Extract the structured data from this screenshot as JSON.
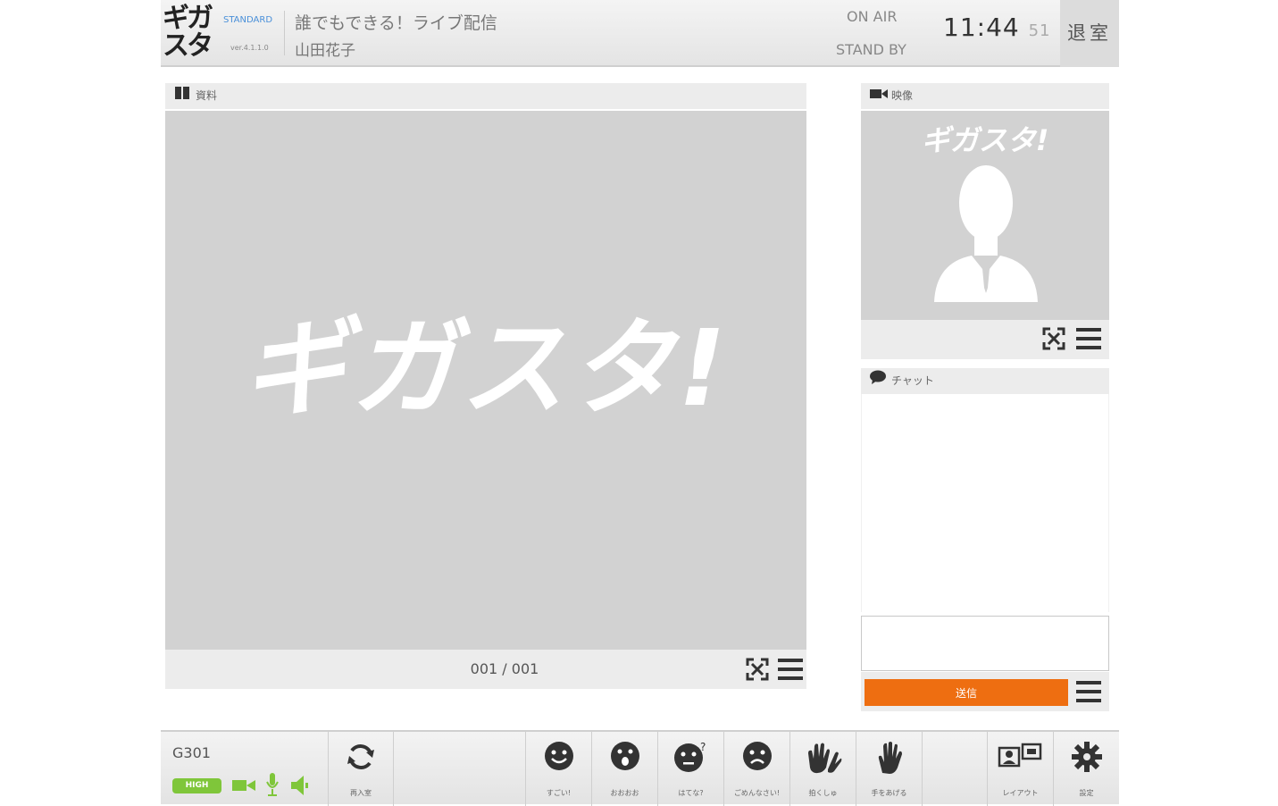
{
  "header": {
    "logo": "ギガスタ",
    "edition": "STANDARD",
    "version": "ver.4.1.1.0",
    "room_title": "誰でもできる！ライブ配信",
    "user_name": "山田花子",
    "status_onair": "ON AIR",
    "status_standby": "STAND BY",
    "clock_hm": "11:44",
    "clock_sec": "51",
    "exit_label": "退室"
  },
  "document_panel": {
    "title": "資料",
    "logo_text": "ギガスタ!",
    "page_counter": "001 / 001"
  },
  "video_panel": {
    "title": "映像",
    "logo_text": "ギガスタ!"
  },
  "chat_panel": {
    "title": "チャット",
    "input_value": "",
    "send_label": "送信"
  },
  "toolbar": {
    "room_code": "G301",
    "quality_label": "HIGH",
    "rejoin_label": "再入室",
    "reactions": [
      {
        "label": "すごい!"
      },
      {
        "label": "おおおお"
      },
      {
        "label": "はてな?"
      },
      {
        "label": "ごめんなさい!"
      },
      {
        "label": "拍くしゅ"
      },
      {
        "label": "手をあげる"
      }
    ],
    "layout_label": "レイアウト",
    "settings_label": "設定"
  },
  "colors": {
    "accent": "#ee6e11",
    "status_green": "#7fc63a",
    "placeholder_gray": "#d2d2d2"
  }
}
